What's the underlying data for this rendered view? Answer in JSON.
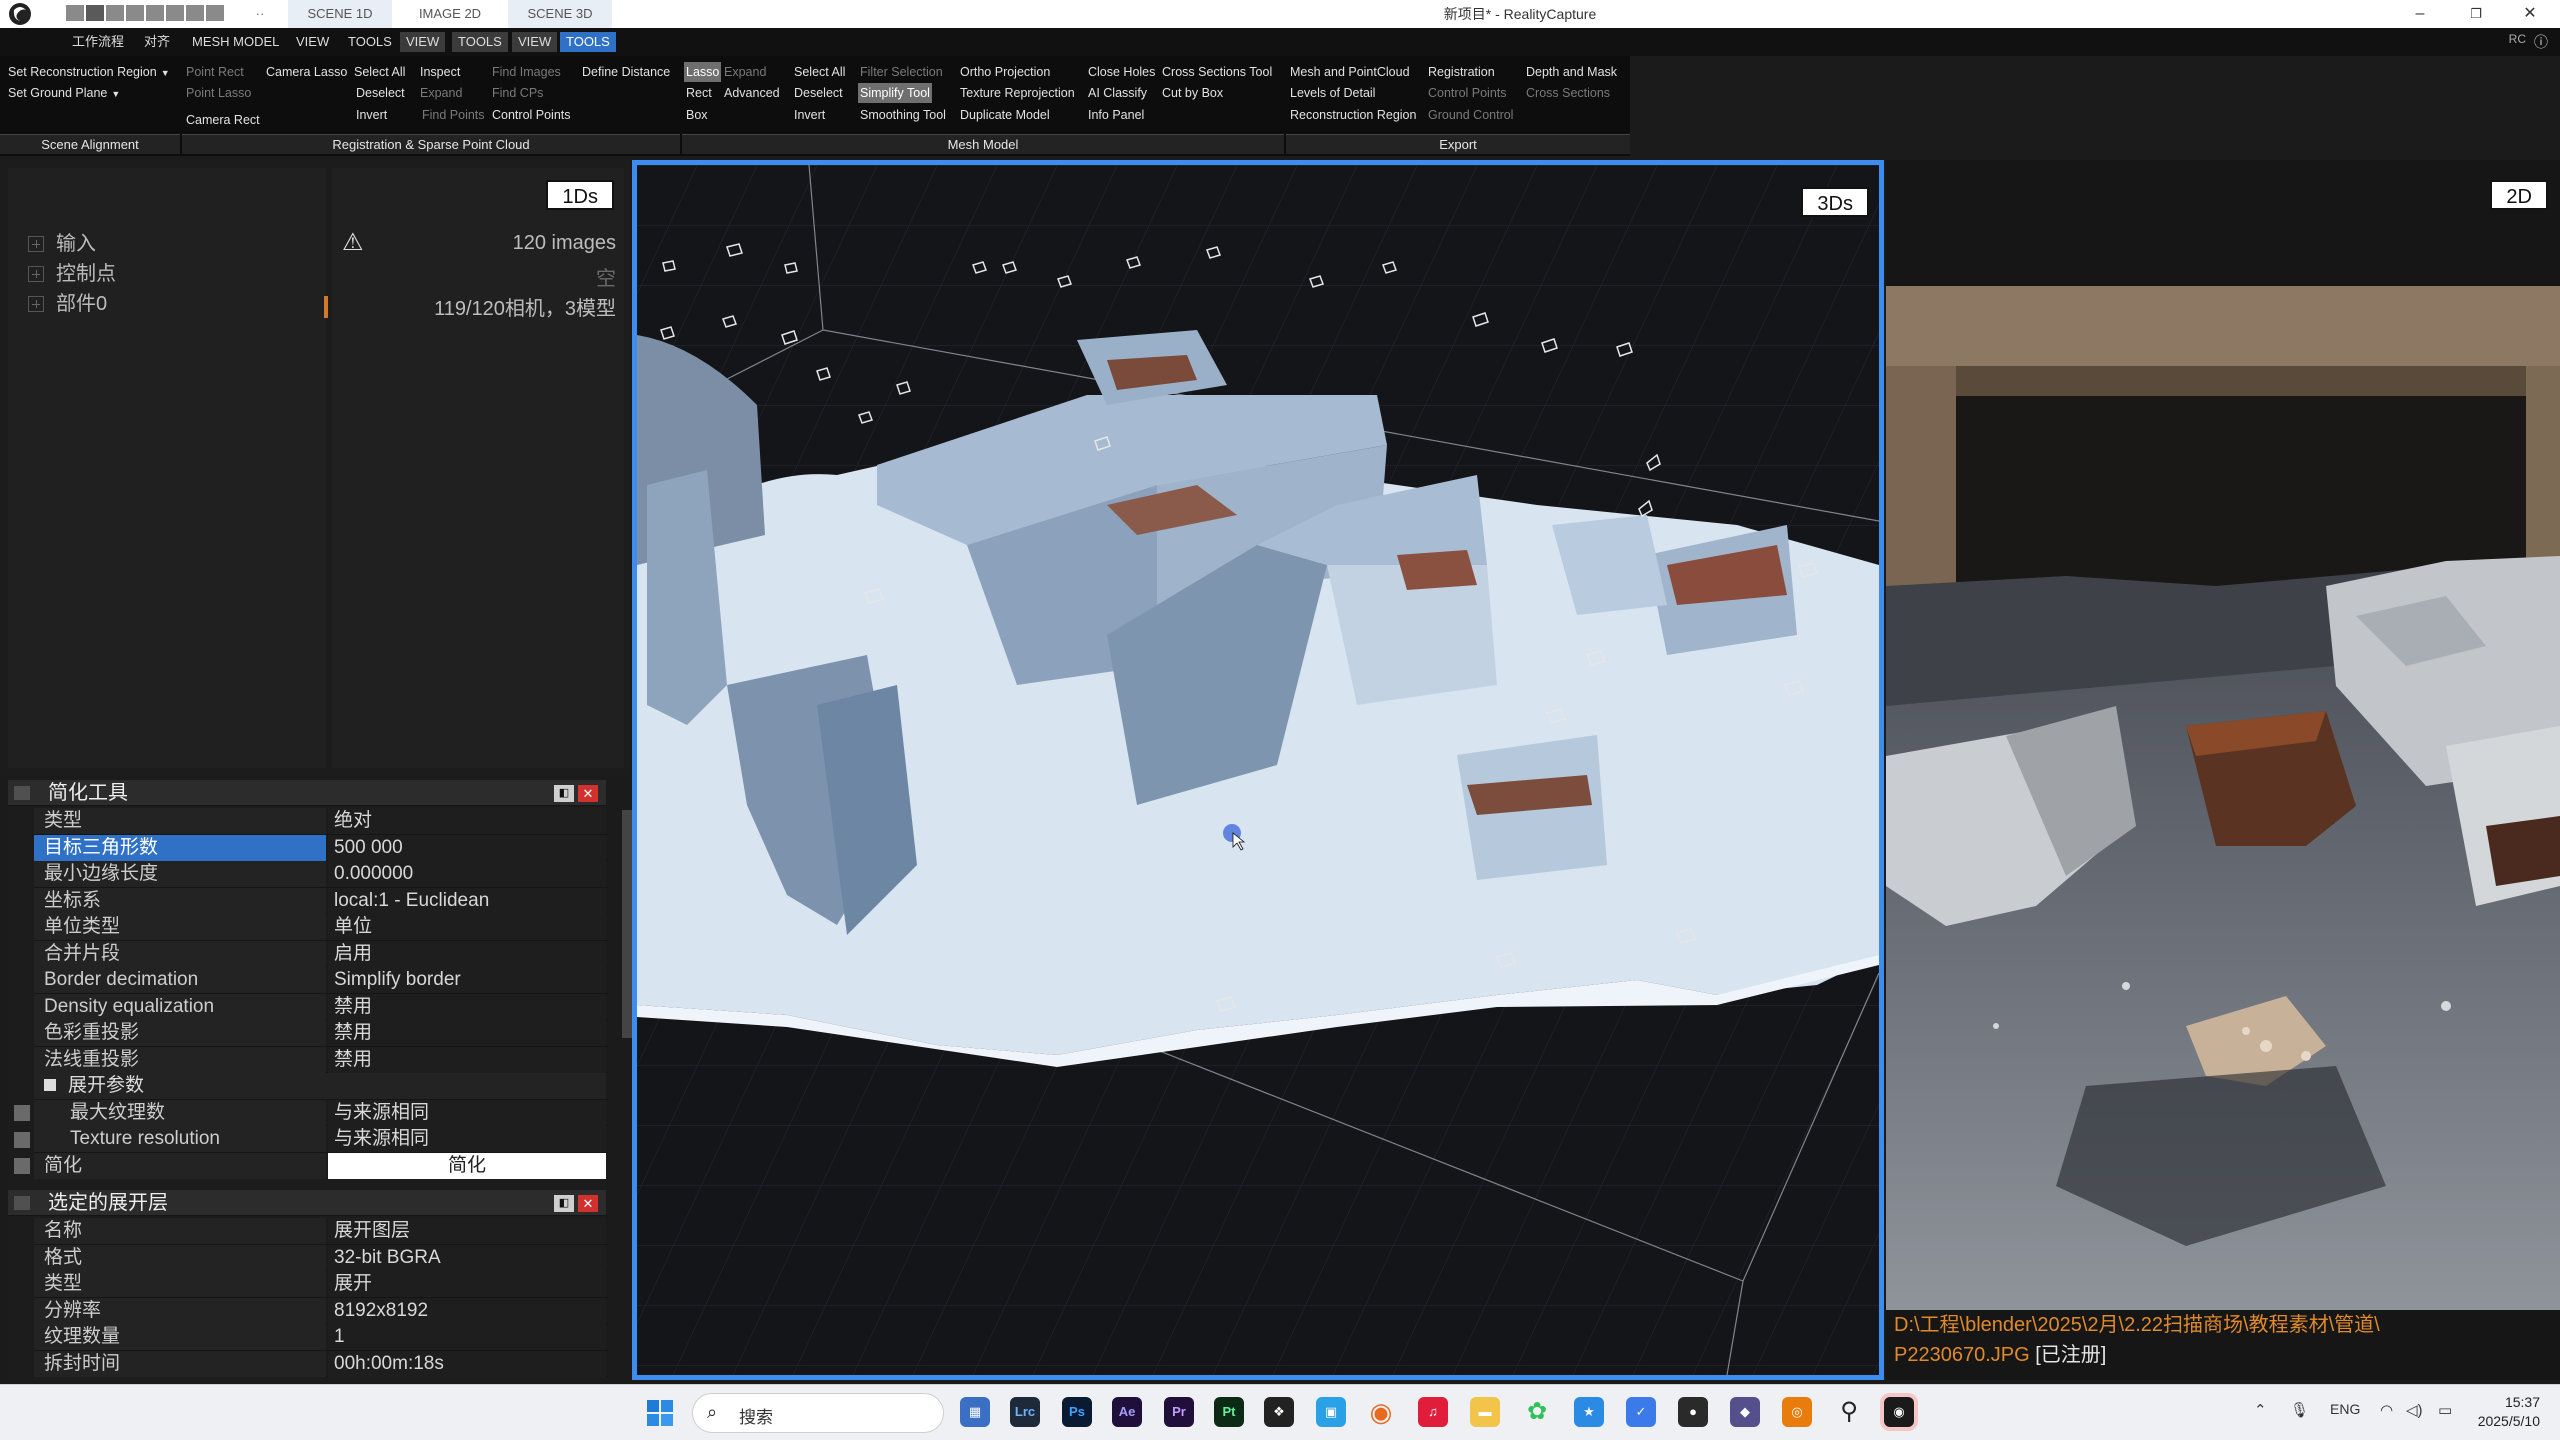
{
  "titlebar": {
    "title": "新项目* - RealityCapture",
    "tabs": [
      "SCENE 1D",
      "IMAGE 2D",
      "SCENE 3D"
    ],
    "more_label": "··",
    "min_icon": "–",
    "max_icon": "❐",
    "close_icon": "✕"
  },
  "menubar": {
    "items": [
      "工作流程",
      "对齐",
      "MESH MODEL",
      "VIEW",
      "TOOLS",
      "VIEW",
      "TOOLS",
      "VIEW",
      "TOOLS"
    ],
    "rc_label": "RC",
    "help_icon": "ⓘ"
  },
  "ribbon": {
    "scene_alignment": {
      "set_recon_region": "Set Reconstruction Region",
      "set_ground_plane": "Set Ground Plane",
      "label": "Scene Alignment"
    },
    "registration": {
      "point_rect": "Point Rect",
      "point_lasso": "Point Lasso",
      "camera_rect": "Camera Rect",
      "camera_lasso": "Camera Lasso",
      "select_all": "Select All",
      "deselect": "Deselect",
      "invert": "Invert",
      "inspect": "Inspect",
      "expand": "Expand",
      "find_points": "Find Points",
      "find_images": "Find Images",
      "find_cps": "Find CPs",
      "control_points": "Control Points",
      "define_distance": "Define Distance",
      "label": "Registration & Sparse Point Cloud"
    },
    "mesh_model": {
      "lasso": "Lasso",
      "expand": "Expand",
      "rect": "Rect",
      "advanced": "Advanced",
      "box": "Box",
      "select_all": "Select All",
      "deselect": "Deselect",
      "invert": "Invert",
      "filter_selection": "Filter Selection",
      "simplify_tool": "Simplify Tool",
      "smoothing_tool": "Smoothing Tool",
      "ortho_projection": "Ortho Projection",
      "texture_reprojection": "Texture Reprojection",
      "duplicate_model": "Duplicate Model",
      "close_holes": "Close Holes",
      "ai_classify": "AI Classify",
      "info_panel": "Info Panel",
      "cross_sections_tool": "Cross Sections Tool",
      "cut_by_box": "Cut by Box",
      "label": "Mesh Model"
    },
    "export": {
      "mesh_pointcloud": "Mesh and PointCloud",
      "levels_of_detail": "Levels of Detail",
      "reconstruction_region": "Reconstruction Region",
      "registration": "Registration",
      "control_points": "Control Points",
      "ground_control": "Ground Control",
      "depth_mask": "Depth and Mask",
      "cross_sections": "Cross Sections",
      "label": "Export"
    }
  },
  "panel_1ds": {
    "badge": "1Ds",
    "tree": [
      "输入",
      "控制点",
      "部件0"
    ],
    "images": "120 images",
    "empty": "空",
    "cameras": "119/120相机，3模型"
  },
  "simplify_panel": {
    "title": "简化工具",
    "rows": [
      {
        "k": "类型",
        "v": "绝对"
      },
      {
        "k": "目标三角形数",
        "v": "500 000"
      },
      {
        "k": "最小边缘长度",
        "v": "0.000000"
      },
      {
        "k": "坐标系",
        "v": "local:1 - Euclidean"
      },
      {
        "k": "单位类型",
        "v": "单位"
      },
      {
        "k": "合并片段",
        "v": "启用"
      },
      {
        "k": "Border decimation",
        "v": "Simplify border"
      },
      {
        "k": "Density equalization",
        "v": "禁用"
      },
      {
        "k": "色彩重投影",
        "v": "禁用"
      },
      {
        "k": "法线重投影",
        "v": "禁用"
      }
    ],
    "section": "展开参数",
    "sub_rows": [
      {
        "k": "最大纹理数",
        "v": "与来源相同"
      },
      {
        "k": "Texture resolution",
        "v": "与来源相同"
      }
    ],
    "action_label": "简化",
    "action_button": "简化"
  },
  "unwrap_panel": {
    "title": "选定的展开层",
    "rows": [
      {
        "k": "名称",
        "v": "展开图层"
      },
      {
        "k": "格式",
        "v": "32-bit BGRA"
      },
      {
        "k": "类型",
        "v": "展开"
      },
      {
        "k": "分辨率",
        "v": "8192x8192"
      },
      {
        "k": "纹理数量",
        "v": "1"
      },
      {
        "k": "拆封时间",
        "v": "00h:00m:18s"
      }
    ]
  },
  "panel_common": {
    "pin": "◧",
    "close": "✕"
  },
  "viewport_3d": {
    "badge": "3Ds"
  },
  "viewport_2d": {
    "badge": "2D",
    "path": "D:\\工程\\blender\\2025\\2月\\2.22扫描商场\\教程素材\\管道\\",
    "file": "P2230670.JPG",
    "status": "[已注册]"
  },
  "taskbar": {
    "search_placeholder": "搜索",
    "search_icon": "⌕",
    "apps": [
      "Lrc",
      "Ps",
      "Ae",
      "Pr",
      "Pt"
    ],
    "lang": "ENG",
    "time": "15:37",
    "date": "2025/5/10",
    "tray_up": "⌃",
    "mic": "🎙",
    "wifi": "◠",
    "volume": "◁)",
    "battery": "▭"
  },
  "colors": {
    "accent": "#2f71c7",
    "viewport_border": "#3d8df0",
    "orange": "#e08a2a"
  }
}
